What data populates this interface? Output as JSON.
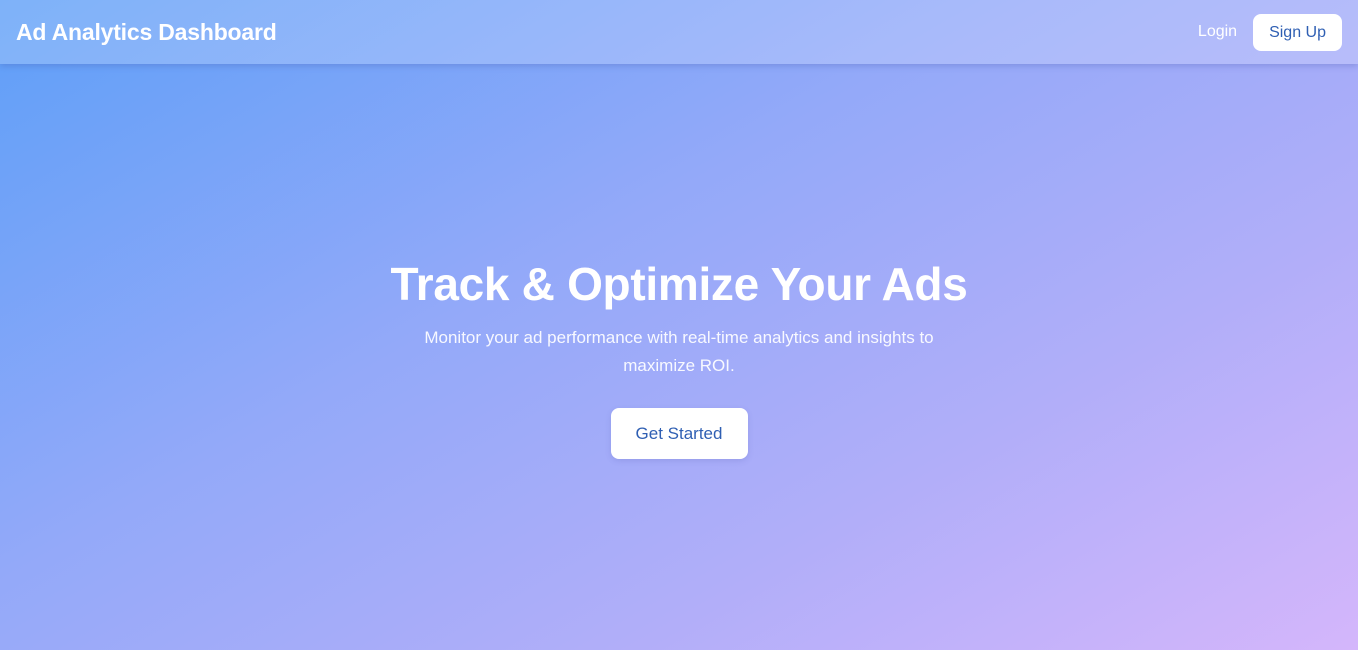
{
  "navbar": {
    "brand": "Ad Analytics Dashboard",
    "login_label": "Login",
    "signup_label": "Sign Up"
  },
  "hero": {
    "title": "Track & Optimize Your Ads",
    "subtitle": "Monitor your ad performance with real-time analytics and insights to maximize ROI.",
    "cta_label": "Get Started"
  },
  "colors": {
    "gradient_start": "#5e9ff8",
    "gradient_end": "#d4b6fb",
    "button_text": "#2f5fb3",
    "button_background": "#ffffff"
  }
}
